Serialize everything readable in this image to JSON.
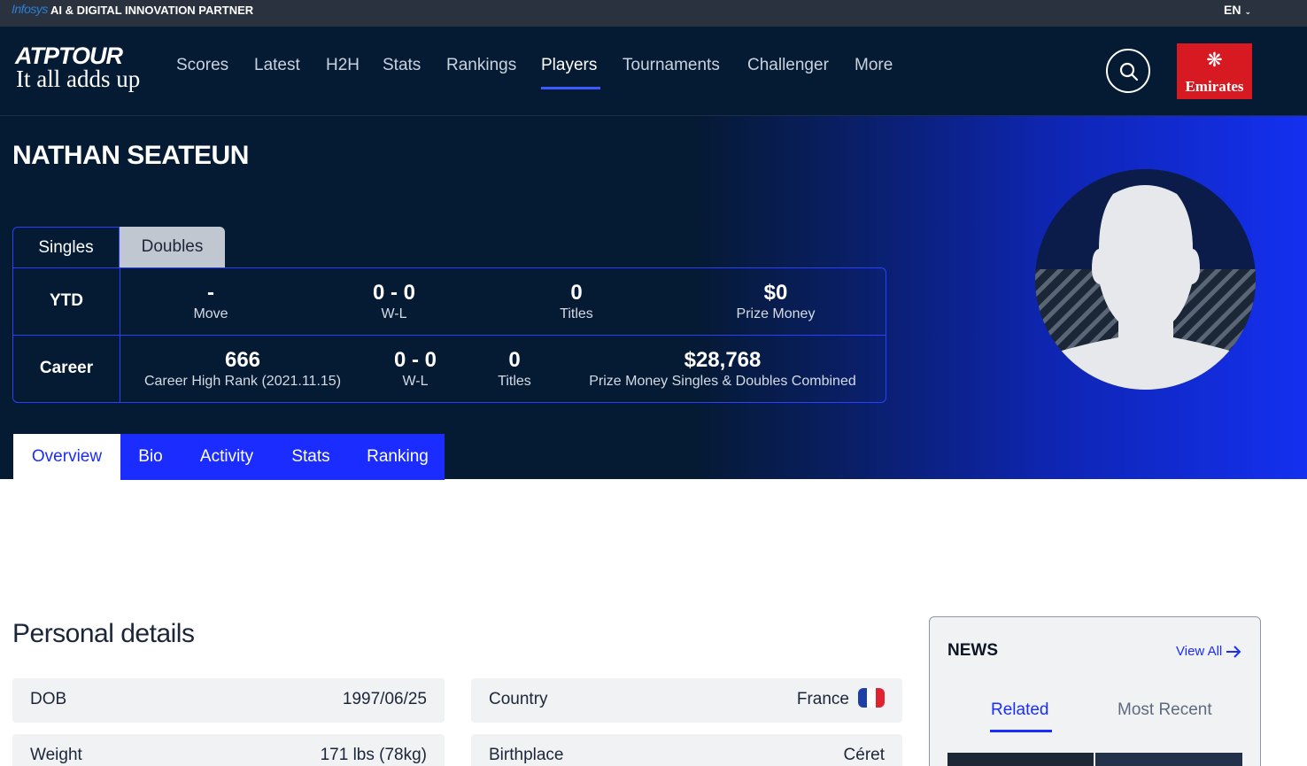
{
  "partner_bar": {
    "brand": "Infosys",
    "text": "AI & DIGITAL INNOVATION PARTNER",
    "language": "EN"
  },
  "logo": {
    "name": "ATPTOUR",
    "slogan": "It all adds up"
  },
  "nav": {
    "items": [
      "Scores",
      "Latest",
      "H2H",
      "Stats",
      "Rankings",
      "Players",
      "Tournaments",
      "Challenger",
      "More"
    ],
    "active": "Players",
    "sponsor": "Emirates"
  },
  "player": {
    "name": "NATHAN SEATEUN"
  },
  "stat_tabs": {
    "singles": "Singles",
    "doubles": "Doubles"
  },
  "ytd": {
    "label": "YTD",
    "move": {
      "value": "-",
      "label": "Move"
    },
    "wl": {
      "value": "0 - 0",
      "label": "W-L"
    },
    "titles": {
      "value": "0",
      "label": "Titles"
    },
    "prize": {
      "value": "$0",
      "label": "Prize Money"
    }
  },
  "career": {
    "label": "Career",
    "rank": {
      "value": "666",
      "label": "Career High Rank (2021.11.15)"
    },
    "wl": {
      "value": "0 - 0",
      "label": "W-L"
    },
    "titles": {
      "value": "0",
      "label": "Titles"
    },
    "prize": {
      "value": "$28,768",
      "label": "Prize Money Singles & Doubles Combined"
    }
  },
  "profile_tabs": [
    "Overview",
    "Bio",
    "Activity",
    "Stats",
    "Ranking"
  ],
  "personal_details": {
    "title": "Personal details",
    "dob": {
      "label": "DOB",
      "value": "1997/06/25"
    },
    "country": {
      "label": "Country",
      "value": "France"
    },
    "weight": {
      "label": "Weight",
      "value": "171 lbs (78kg)"
    },
    "birthplace": {
      "label": "Birthplace",
      "value": "Céret"
    }
  },
  "news": {
    "title": "NEWS",
    "view_all": "View All",
    "tabs": [
      "Related",
      "Most Recent"
    ],
    "active_tab": "Related"
  },
  "colors": {
    "accent_blue": "#1a2cff",
    "navy": "#051a33",
    "emirates_red": "#d71921"
  },
  "icons": [
    "search-icon",
    "chevron-down-icon",
    "arrow-right-icon",
    "player-silhouette-icon",
    "france-flag-icon"
  ]
}
